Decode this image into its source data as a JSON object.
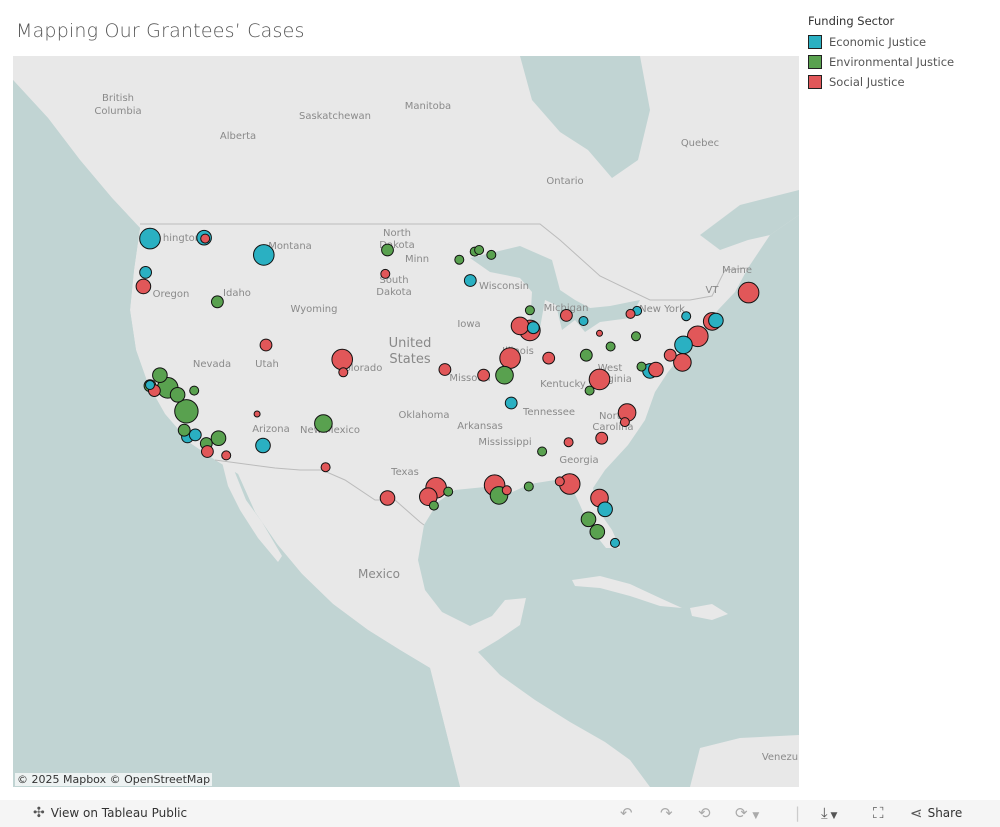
{
  "title": "Mapping Our Grantees’ Cases",
  "legend": {
    "title": "Funding Sector",
    "items": [
      {
        "label": "Economic Justice",
        "color": "#2ab0c2"
      },
      {
        "label": "Environmental Justice",
        "color": "#59a14f"
      },
      {
        "label": "Social Justice",
        "color": "#e15759"
      }
    ]
  },
  "map": {
    "attribution": "© 2025 Mapbox © OpenStreetMap",
    "land_color": "#e8e8e8",
    "water_color": "#c1d4d3",
    "labels": [
      "British",
      "Columbia",
      "Alberta",
      "Saskatchewan",
      "Manitoba",
      "Ontario",
      "Quebec",
      "hington",
      "Montana",
      "North",
      "Dakota",
      "South",
      "Dakota",
      "Minn",
      "Wisconsin",
      "Michigan",
      "New York",
      "VT",
      "Maine",
      "Oregon",
      "Idaho",
      "Wyoming",
      "Iowa",
      "United",
      "States",
      "Nevada",
      "Utah",
      "Colorado",
      "Missouri",
      "Illinois",
      "Kentucky",
      "West",
      "Virginia",
      "Tennessee",
      "North",
      "Carolina",
      "Oklahoma",
      "Arkansas",
      "Mississippi",
      "Georgia",
      "Arizona",
      "New Mexico",
      "Texas",
      "Mexico",
      "Venezu"
    ]
  },
  "chart_data": {
    "type": "scatter",
    "projection": "web-mercator",
    "color_by": "Funding Sector",
    "points": [
      {
        "lon": -122.3,
        "lat": 47.6,
        "size": 5,
        "sector": "Economic Justice"
      },
      {
        "lon": -117.4,
        "lat": 47.66,
        "size": 3,
        "sector": "Economic Justice"
      },
      {
        "lon": -112.0,
        "lat": 46.6,
        "size": 5,
        "sector": "Economic Justice"
      },
      {
        "lon": -122.7,
        "lat": 45.5,
        "size": 2,
        "sector": "Economic Justice"
      },
      {
        "lon": -93.3,
        "lat": 44.98,
        "size": 2,
        "sector": "Economic Justice"
      },
      {
        "lon": -87.6,
        "lat": 41.88,
        "size": 2,
        "sector": "Economic Justice"
      },
      {
        "lon": -83.05,
        "lat": 42.33,
        "size": 1,
        "sector": "Economic Justice"
      },
      {
        "lon": -78.2,
        "lat": 43.0,
        "size": 1,
        "sector": "Economic Justice"
      },
      {
        "lon": -73.75,
        "lat": 42.65,
        "size": 1,
        "sector": "Economic Justice"
      },
      {
        "lon": -71.06,
        "lat": 42.36,
        "size": 3,
        "sector": "Economic Justice"
      },
      {
        "lon": -74.0,
        "lat": 40.71,
        "size": 4,
        "sector": "Economic Justice"
      },
      {
        "lon": -77.03,
        "lat": 38.9,
        "size": 3,
        "sector": "Economic Justice"
      },
      {
        "lon": -89.6,
        "lat": 36.6,
        "size": 2,
        "sector": "Economic Justice"
      },
      {
        "lon": -81.1,
        "lat": 28.5,
        "size": 3,
        "sector": "Economic Justice"
      },
      {
        "lon": -80.2,
        "lat": 25.8,
        "size": 1,
        "sector": "Economic Justice"
      },
      {
        "lon": -112.07,
        "lat": 33.45,
        "size": 3,
        "sector": "Economic Justice"
      },
      {
        "lon": -118.9,
        "lat": 34.1,
        "size": 2,
        "sector": "Economic Justice"
      },
      {
        "lon": -118.2,
        "lat": 34.25,
        "size": 2,
        "sector": "Economic Justice"
      },
      {
        "lon": -122.3,
        "lat": 37.9,
        "size": 1,
        "sector": "Economic Justice"
      },
      {
        "lon": -100.8,
        "lat": 46.9,
        "size": 2,
        "sector": "Environmental Justice"
      },
      {
        "lon": -94.3,
        "lat": 46.3,
        "size": 1,
        "sector": "Environmental Justice"
      },
      {
        "lon": -92.9,
        "lat": 46.8,
        "size": 1,
        "sector": "Environmental Justice"
      },
      {
        "lon": -92.5,
        "lat": 46.9,
        "size": 1,
        "sector": "Environmental Justice"
      },
      {
        "lon": -91.4,
        "lat": 46.6,
        "size": 1,
        "sector": "Environmental Justice"
      },
      {
        "lon": -87.9,
        "lat": 43.04,
        "size": 1,
        "sector": "Environmental Justice"
      },
      {
        "lon": -116.2,
        "lat": 43.6,
        "size": 2,
        "sector": "Environmental Justice"
      },
      {
        "lon": -82.8,
        "lat": 40.0,
        "size": 2,
        "sector": "Environmental Justice"
      },
      {
        "lon": -80.6,
        "lat": 40.6,
        "size": 1,
        "sector": "Environmental Justice"
      },
      {
        "lon": -78.3,
        "lat": 41.3,
        "size": 1,
        "sector": "Environmental Justice"
      },
      {
        "lon": -77.8,
        "lat": 39.2,
        "size": 1,
        "sector": "Environmental Justice"
      },
      {
        "lon": -82.5,
        "lat": 37.5,
        "size": 1,
        "sector": "Environmental Justice"
      },
      {
        "lon": -90.2,
        "lat": 38.6,
        "size": 4,
        "sector": "Environmental Justice"
      },
      {
        "lon": -121.4,
        "lat": 38.6,
        "size": 3,
        "sector": "Environmental Justice"
      },
      {
        "lon": -120.7,
        "lat": 37.7,
        "size": 5,
        "sector": "Environmental Justice"
      },
      {
        "lon": -122.3,
        "lat": 37.85,
        "size": 2,
        "sector": "Environmental Justice"
      },
      {
        "lon": -119.8,
        "lat": 37.2,
        "size": 3,
        "sector": "Environmental Justice"
      },
      {
        "lon": -119.0,
        "lat": 36.0,
        "size": 6,
        "sector": "Environmental Justice"
      },
      {
        "lon": -118.3,
        "lat": 37.5,
        "size": 1,
        "sector": "Environmental Justice"
      },
      {
        "lon": -119.2,
        "lat": 34.6,
        "size": 2,
        "sector": "Environmental Justice"
      },
      {
        "lon": -116.1,
        "lat": 34.0,
        "size": 3,
        "sector": "Environmental Justice"
      },
      {
        "lon": -117.2,
        "lat": 33.6,
        "size": 2,
        "sector": "Environmental Justice"
      },
      {
        "lon": -106.6,
        "lat": 35.1,
        "size": 4,
        "sector": "Environmental Justice"
      },
      {
        "lon": -90.7,
        "lat": 29.6,
        "size": 4,
        "sector": "Environmental Justice"
      },
      {
        "lon": -88.0,
        "lat": 30.3,
        "size": 1,
        "sector": "Environmental Justice"
      },
      {
        "lon": -86.8,
        "lat": 33.0,
        "size": 1,
        "sector": "Environmental Justice"
      },
      {
        "lon": -95.3,
        "lat": 29.9,
        "size": 1,
        "sector": "Environmental Justice"
      },
      {
        "lon": -96.6,
        "lat": 28.8,
        "size": 1,
        "sector": "Environmental Justice"
      },
      {
        "lon": -82.6,
        "lat": 27.7,
        "size": 3,
        "sector": "Environmental Justice"
      },
      {
        "lon": -81.8,
        "lat": 26.7,
        "size": 3,
        "sector": "Environmental Justice"
      },
      {
        "lon": -117.3,
        "lat": 47.6,
        "size": 1,
        "sector": "Social Justice"
      },
      {
        "lon": -122.9,
        "lat": 44.6,
        "size": 3,
        "sector": "Social Justice"
      },
      {
        "lon": -101.0,
        "lat": 45.4,
        "size": 1,
        "sector": "Social Justice"
      },
      {
        "lon": -111.8,
        "lat": 40.7,
        "size": 2,
        "sector": "Social Justice"
      },
      {
        "lon": -104.9,
        "lat": 39.7,
        "size": 5,
        "sector": "Social Justice"
      },
      {
        "lon": -104.8,
        "lat": 38.8,
        "size": 1,
        "sector": "Social Justice"
      },
      {
        "lon": -112.6,
        "lat": 35.8,
        "size": 0,
        "sector": "Social Justice"
      },
      {
        "lon": -115.4,
        "lat": 32.7,
        "size": 1,
        "sector": "Social Justice"
      },
      {
        "lon": -117.1,
        "lat": 33.0,
        "size": 2,
        "sector": "Social Justice"
      },
      {
        "lon": -121.9,
        "lat": 37.5,
        "size": 2,
        "sector": "Social Justice"
      },
      {
        "lon": -95.6,
        "lat": 39.0,
        "size": 2,
        "sector": "Social Justice"
      },
      {
        "lon": -92.1,
        "lat": 38.6,
        "size": 2,
        "sector": "Social Justice"
      },
      {
        "lon": -89.7,
        "lat": 39.8,
        "size": 5,
        "sector": "Social Justice"
      },
      {
        "lon": -88.8,
        "lat": 42.0,
        "size": 4,
        "sector": "Social Justice"
      },
      {
        "lon": -87.9,
        "lat": 41.7,
        "size": 5,
        "sector": "Social Justice"
      },
      {
        "lon": -86.2,
        "lat": 39.8,
        "size": 2,
        "sector": "Social Justice"
      },
      {
        "lon": -84.6,
        "lat": 42.7,
        "size": 2,
        "sector": "Social Justice"
      },
      {
        "lon": -81.6,
        "lat": 41.5,
        "size": 0,
        "sector": "Social Justice"
      },
      {
        "lon": -78.8,
        "lat": 42.8,
        "size": 1,
        "sector": "Social Justice"
      },
      {
        "lon": -75.2,
        "lat": 40.0,
        "size": 2,
        "sector": "Social Justice"
      },
      {
        "lon": -74.1,
        "lat": 39.5,
        "size": 4,
        "sector": "Social Justice"
      },
      {
        "lon": -72.7,
        "lat": 41.3,
        "size": 5,
        "sector": "Social Justice"
      },
      {
        "lon": -71.4,
        "lat": 42.3,
        "size": 4,
        "sector": "Social Justice"
      },
      {
        "lon": -68.1,
        "lat": 44.2,
        "size": 5,
        "sector": "Social Justice"
      },
      {
        "lon": -81.6,
        "lat": 38.3,
        "size": 5,
        "sector": "Social Justice"
      },
      {
        "lon": -76.5,
        "lat": 39.0,
        "size": 3,
        "sector": "Social Justice"
      },
      {
        "lon": -79.1,
        "lat": 35.9,
        "size": 4,
        "sector": "Social Justice"
      },
      {
        "lon": -79.3,
        "lat": 35.2,
        "size": 1,
        "sector": "Social Justice"
      },
      {
        "lon": -81.4,
        "lat": 34.0,
        "size": 2,
        "sector": "Social Justice"
      },
      {
        "lon": -84.4,
        "lat": 33.7,
        "size": 1,
        "sector": "Social Justice"
      },
      {
        "lon": -84.3,
        "lat": 30.5,
        "size": 5,
        "sector": "Social Justice"
      },
      {
        "lon": -85.2,
        "lat": 30.7,
        "size": 1,
        "sector": "Social Justice"
      },
      {
        "lon": -81.6,
        "lat": 29.4,
        "size": 4,
        "sector": "Social Justice"
      },
      {
        "lon": -91.1,
        "lat": 30.4,
        "size": 5,
        "sector": "Social Justice"
      },
      {
        "lon": -90.0,
        "lat": 30.0,
        "size": 1,
        "sector": "Social Justice"
      },
      {
        "lon": -96.4,
        "lat": 30.2,
        "size": 5,
        "sector": "Social Justice"
      },
      {
        "lon": -97.1,
        "lat": 29.5,
        "size": 4,
        "sector": "Social Justice"
      },
      {
        "lon": -100.8,
        "lat": 29.4,
        "size": 3,
        "sector": "Social Justice"
      },
      {
        "lon": -106.4,
        "lat": 31.8,
        "size": 1,
        "sector": "Social Justice"
      }
    ]
  },
  "toolbar": {
    "view_label": "View on Tableau Public",
    "share_label": "Share",
    "icons": [
      "tableau-logo-icon",
      "undo-icon",
      "redo-icon",
      "revert-icon",
      "refresh-icon",
      "download-icon",
      "fullscreen-icon",
      "share-icon"
    ]
  }
}
